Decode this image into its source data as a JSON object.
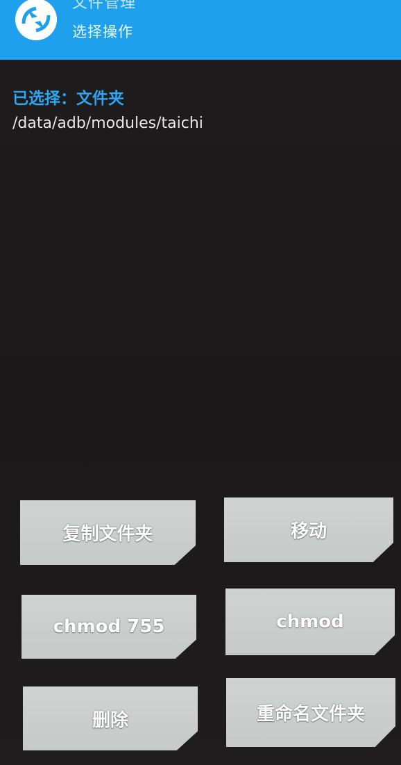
{
  "header": {
    "title": "文件管理",
    "subtitle": "选择操作",
    "logo_icon": "twrp-logo-icon",
    "background_color": "#1ea0ec"
  },
  "selection": {
    "label": "已选择：文件夹",
    "path": "/data/adb/modules/taichi",
    "label_color": "#2aa6f2"
  },
  "actions": {
    "copy_folder": "复制文件夹",
    "move": "移动",
    "chmod_755": "chmod 755",
    "chmod": "chmod",
    "delete": "删除",
    "rename_folder": "重命名文件夹"
  }
}
